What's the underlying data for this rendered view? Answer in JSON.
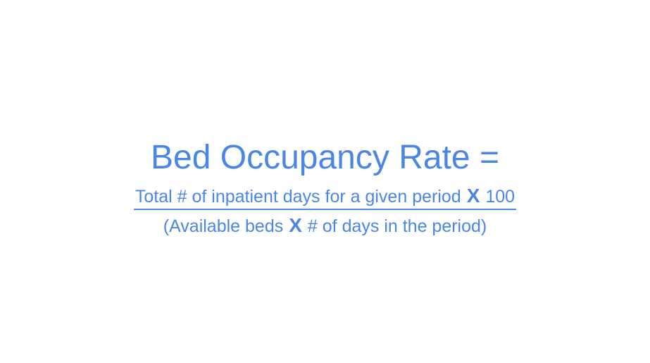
{
  "formula": {
    "title": "Bed Occupancy Rate =",
    "numerator": {
      "text": "Total # of inpatient days for a given period",
      "operator": "X",
      "multiplier": "100"
    },
    "denominator": {
      "open": "(Available beds",
      "operator": "X",
      "close": "# of days in the period)"
    }
  },
  "colors": {
    "text": "#4a86e8",
    "background": "#ffffff"
  }
}
